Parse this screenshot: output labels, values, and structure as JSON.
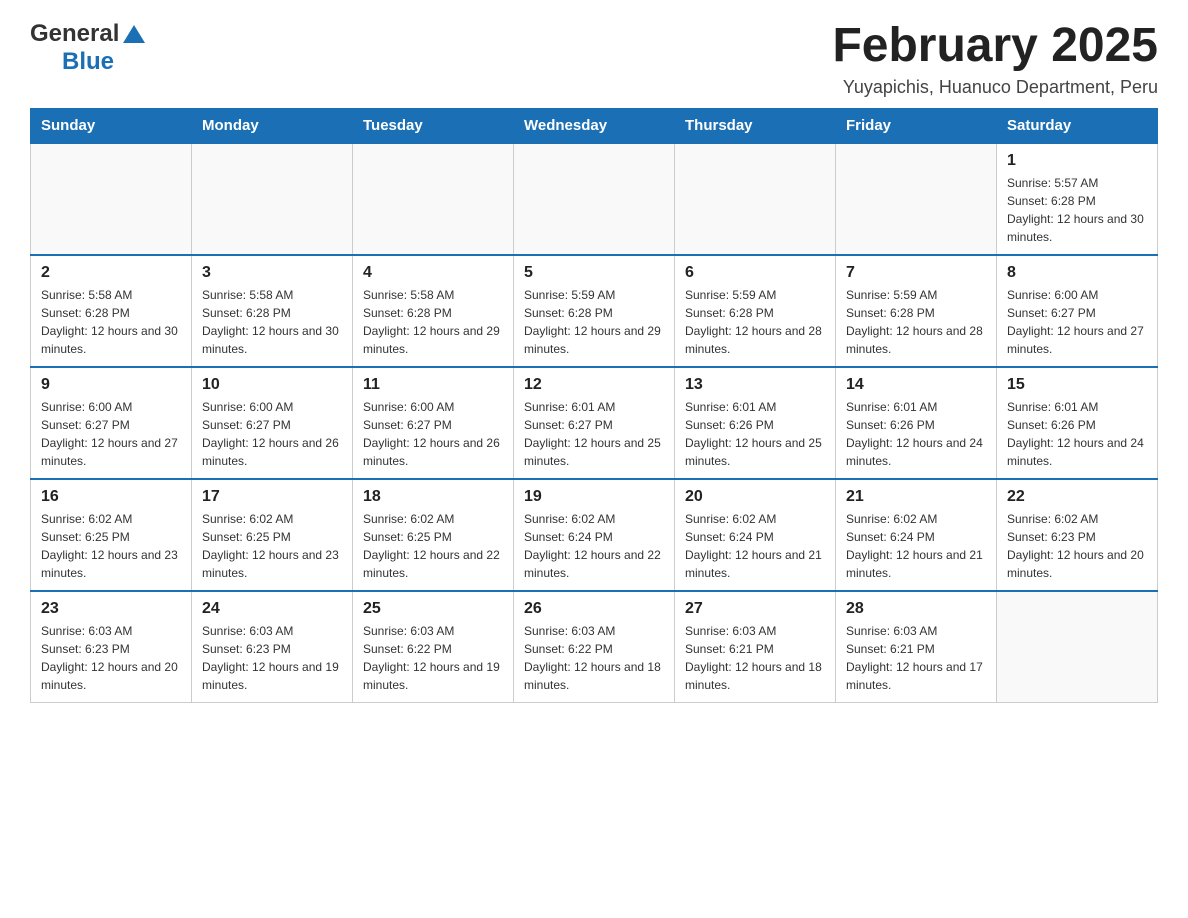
{
  "header": {
    "logo": {
      "text_general": "General",
      "text_blue": "Blue"
    },
    "title": "February 2025",
    "location": "Yuyapichis, Huanuco Department, Peru"
  },
  "days_of_week": [
    "Sunday",
    "Monday",
    "Tuesday",
    "Wednesday",
    "Thursday",
    "Friday",
    "Saturday"
  ],
  "weeks": [
    [
      {
        "day": "",
        "sunrise": "",
        "sunset": "",
        "daylight": ""
      },
      {
        "day": "",
        "sunrise": "",
        "sunset": "",
        "daylight": ""
      },
      {
        "day": "",
        "sunrise": "",
        "sunset": "",
        "daylight": ""
      },
      {
        "day": "",
        "sunrise": "",
        "sunset": "",
        "daylight": ""
      },
      {
        "day": "",
        "sunrise": "",
        "sunset": "",
        "daylight": ""
      },
      {
        "day": "",
        "sunrise": "",
        "sunset": "",
        "daylight": ""
      },
      {
        "day": "1",
        "sunrise": "Sunrise: 5:57 AM",
        "sunset": "Sunset: 6:28 PM",
        "daylight": "Daylight: 12 hours and 30 minutes."
      }
    ],
    [
      {
        "day": "2",
        "sunrise": "Sunrise: 5:58 AM",
        "sunset": "Sunset: 6:28 PM",
        "daylight": "Daylight: 12 hours and 30 minutes."
      },
      {
        "day": "3",
        "sunrise": "Sunrise: 5:58 AM",
        "sunset": "Sunset: 6:28 PM",
        "daylight": "Daylight: 12 hours and 30 minutes."
      },
      {
        "day": "4",
        "sunrise": "Sunrise: 5:58 AM",
        "sunset": "Sunset: 6:28 PM",
        "daylight": "Daylight: 12 hours and 29 minutes."
      },
      {
        "day": "5",
        "sunrise": "Sunrise: 5:59 AM",
        "sunset": "Sunset: 6:28 PM",
        "daylight": "Daylight: 12 hours and 29 minutes."
      },
      {
        "day": "6",
        "sunrise": "Sunrise: 5:59 AM",
        "sunset": "Sunset: 6:28 PM",
        "daylight": "Daylight: 12 hours and 28 minutes."
      },
      {
        "day": "7",
        "sunrise": "Sunrise: 5:59 AM",
        "sunset": "Sunset: 6:28 PM",
        "daylight": "Daylight: 12 hours and 28 minutes."
      },
      {
        "day": "8",
        "sunrise": "Sunrise: 6:00 AM",
        "sunset": "Sunset: 6:27 PM",
        "daylight": "Daylight: 12 hours and 27 minutes."
      }
    ],
    [
      {
        "day": "9",
        "sunrise": "Sunrise: 6:00 AM",
        "sunset": "Sunset: 6:27 PM",
        "daylight": "Daylight: 12 hours and 27 minutes."
      },
      {
        "day": "10",
        "sunrise": "Sunrise: 6:00 AM",
        "sunset": "Sunset: 6:27 PM",
        "daylight": "Daylight: 12 hours and 26 minutes."
      },
      {
        "day": "11",
        "sunrise": "Sunrise: 6:00 AM",
        "sunset": "Sunset: 6:27 PM",
        "daylight": "Daylight: 12 hours and 26 minutes."
      },
      {
        "day": "12",
        "sunrise": "Sunrise: 6:01 AM",
        "sunset": "Sunset: 6:27 PM",
        "daylight": "Daylight: 12 hours and 25 minutes."
      },
      {
        "day": "13",
        "sunrise": "Sunrise: 6:01 AM",
        "sunset": "Sunset: 6:26 PM",
        "daylight": "Daylight: 12 hours and 25 minutes."
      },
      {
        "day": "14",
        "sunrise": "Sunrise: 6:01 AM",
        "sunset": "Sunset: 6:26 PM",
        "daylight": "Daylight: 12 hours and 24 minutes."
      },
      {
        "day": "15",
        "sunrise": "Sunrise: 6:01 AM",
        "sunset": "Sunset: 6:26 PM",
        "daylight": "Daylight: 12 hours and 24 minutes."
      }
    ],
    [
      {
        "day": "16",
        "sunrise": "Sunrise: 6:02 AM",
        "sunset": "Sunset: 6:25 PM",
        "daylight": "Daylight: 12 hours and 23 minutes."
      },
      {
        "day": "17",
        "sunrise": "Sunrise: 6:02 AM",
        "sunset": "Sunset: 6:25 PM",
        "daylight": "Daylight: 12 hours and 23 minutes."
      },
      {
        "day": "18",
        "sunrise": "Sunrise: 6:02 AM",
        "sunset": "Sunset: 6:25 PM",
        "daylight": "Daylight: 12 hours and 22 minutes."
      },
      {
        "day": "19",
        "sunrise": "Sunrise: 6:02 AM",
        "sunset": "Sunset: 6:24 PM",
        "daylight": "Daylight: 12 hours and 22 minutes."
      },
      {
        "day": "20",
        "sunrise": "Sunrise: 6:02 AM",
        "sunset": "Sunset: 6:24 PM",
        "daylight": "Daylight: 12 hours and 21 minutes."
      },
      {
        "day": "21",
        "sunrise": "Sunrise: 6:02 AM",
        "sunset": "Sunset: 6:24 PM",
        "daylight": "Daylight: 12 hours and 21 minutes."
      },
      {
        "day": "22",
        "sunrise": "Sunrise: 6:02 AM",
        "sunset": "Sunset: 6:23 PM",
        "daylight": "Daylight: 12 hours and 20 minutes."
      }
    ],
    [
      {
        "day": "23",
        "sunrise": "Sunrise: 6:03 AM",
        "sunset": "Sunset: 6:23 PM",
        "daylight": "Daylight: 12 hours and 20 minutes."
      },
      {
        "day": "24",
        "sunrise": "Sunrise: 6:03 AM",
        "sunset": "Sunset: 6:23 PM",
        "daylight": "Daylight: 12 hours and 19 minutes."
      },
      {
        "day": "25",
        "sunrise": "Sunrise: 6:03 AM",
        "sunset": "Sunset: 6:22 PM",
        "daylight": "Daylight: 12 hours and 19 minutes."
      },
      {
        "day": "26",
        "sunrise": "Sunrise: 6:03 AM",
        "sunset": "Sunset: 6:22 PM",
        "daylight": "Daylight: 12 hours and 18 minutes."
      },
      {
        "day": "27",
        "sunrise": "Sunrise: 6:03 AM",
        "sunset": "Sunset: 6:21 PM",
        "daylight": "Daylight: 12 hours and 18 minutes."
      },
      {
        "day": "28",
        "sunrise": "Sunrise: 6:03 AM",
        "sunset": "Sunset: 6:21 PM",
        "daylight": "Daylight: 12 hours and 17 minutes."
      },
      {
        "day": "",
        "sunrise": "",
        "sunset": "",
        "daylight": ""
      }
    ]
  ]
}
